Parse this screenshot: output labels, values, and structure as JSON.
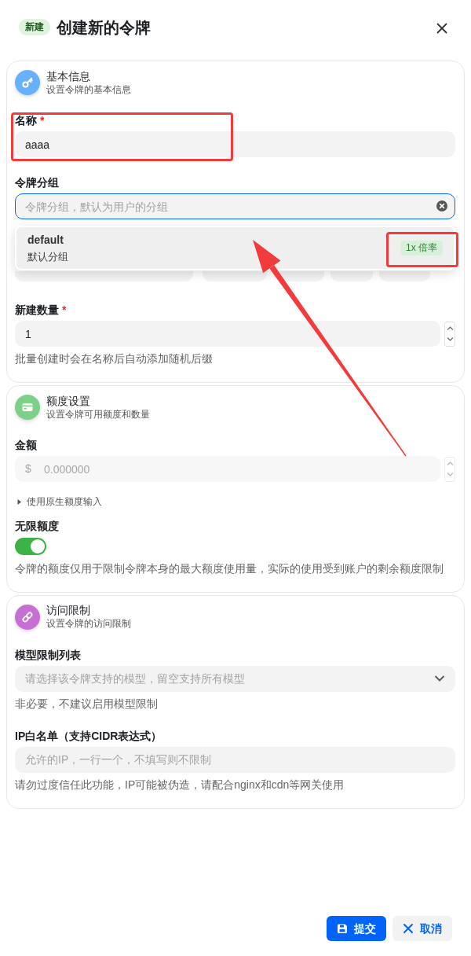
{
  "header": {
    "badge": "新建",
    "title": "创建新的令牌"
  },
  "sections": [
    {
      "title": "基本信息",
      "subtitle": "设置令牌的基本信息",
      "color": "#66b1ff",
      "fields": [
        {
          "kind": "text",
          "label": "名称",
          "required_mark": "*",
          "value": "aaaa"
        },
        {
          "kind": "search_select",
          "label": "令牌分组",
          "placeholder": "令牌分组，默认为用户的分组",
          "focused": true,
          "options": [
            {
              "name": "default",
              "description": "默认分组",
              "tag": "1x 倍率",
              "hovered": true
            }
          ]
        },
        {
          "kind": "covered_row",
          "controls": [
            {
              "kind": "field"
            },
            {
              "kind": "button"
            },
            {
              "kind": "button"
            },
            {
              "kind": "button"
            },
            {
              "kind": "button"
            }
          ]
        },
        {
          "kind": "number",
          "label": "新建数量",
          "required_mark": "*",
          "value": "1",
          "help": "批量创建时会在名称后自动添加随机后缀"
        }
      ]
    },
    {
      "title": "额度设置",
      "subtitle": "设置令牌可用额度和数量",
      "color": "#7dd087",
      "fields": [
        {
          "kind": "amount",
          "label": "金额",
          "prefix": "$",
          "value": "0.000000",
          "disabled": true
        },
        {
          "kind": "disclosure",
          "text": "使用原生额度输入",
          "expanded": false
        },
        {
          "kind": "switch",
          "label": "无限额度",
          "on": true,
          "help": "令牌的额度仅用于限制令牌本身的最大额度使用量，实际的使用受到账户的剩余额度限制"
        }
      ]
    },
    {
      "title": "访问限制",
      "subtitle": "设置令牌的访问限制",
      "color": "#c86fd6",
      "fields": [
        {
          "kind": "select",
          "label": "模型限制列表",
          "placeholder": "请选择该令牌支持的模型，留空支持所有模型",
          "help": "非必要，不建议启用模型限制"
        },
        {
          "kind": "text",
          "label": "IP白名单（支持CIDR表达式）",
          "placeholder": "允许的IP，一行一个，不填写则不限制",
          "help": "请勿过度信任此功能，IP可能被伪造，请配合nginx和cdn等网关使用"
        }
      ]
    }
  ],
  "footer": {
    "buttons": [
      {
        "kind": "primary",
        "label": "提交"
      },
      {
        "kind": "secondary",
        "label": "取消"
      }
    ]
  },
  "annotations": [
    {
      "kind": "frame"
    },
    {
      "kind": "frame"
    },
    {
      "kind": "arrow"
    }
  ]
}
